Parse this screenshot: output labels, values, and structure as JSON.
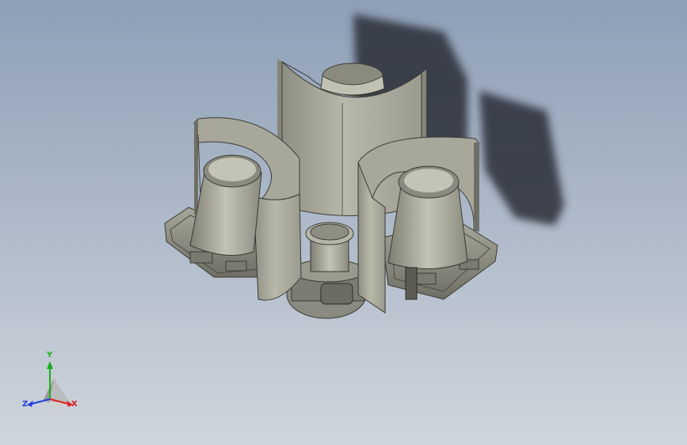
{
  "viewport": {
    "background_top": "#8e9fb6",
    "background_bottom": "#cfd5dc"
  },
  "model": {
    "part_color": "#b4b4a6",
    "shadow_color": "#2b2f38"
  },
  "triad": {
    "x_label": "X",
    "y_label": "Y",
    "z_label": "Z",
    "x_color": "#e02020",
    "y_color": "#18b018",
    "z_color": "#2040e0"
  }
}
